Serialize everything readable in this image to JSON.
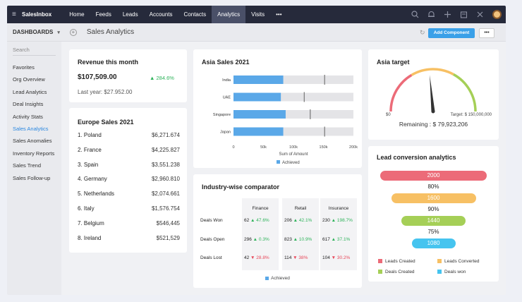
{
  "topbar": {
    "brand": "SalesInbox",
    "nav": [
      "Home",
      "Feeds",
      "Leads",
      "Accounts",
      "Contacts",
      "Analytics",
      "Visits",
      "•••"
    ],
    "active": "Analytics"
  },
  "subbar": {
    "dashboards_label": "DASHBOARDS",
    "breadcrumb": "Sales Analytics",
    "add_component": "Add Component",
    "more": "•••"
  },
  "sidebar": {
    "search_placeholder": "Search",
    "items": [
      "Favorites",
      "Org Overview",
      "Lead Analytics",
      "Deal Insights",
      "Activity Stats",
      "Sales Analytics",
      "Sales Anomalies",
      "Inventory Reports",
      "Sales Trend",
      "Sales Follow-up"
    ],
    "active": "Sales Analytics"
  },
  "revenue": {
    "title": "Revenue this month",
    "amount": "$107,509.00",
    "change": "284.6%",
    "last_year": "Last year:  $27.952.00"
  },
  "europe": {
    "title": "Europe Sales 2021",
    "rows": [
      {
        "name": "1. Poland",
        "value": "$6,271.674"
      },
      {
        "name": "2. France",
        "value": "$4,225.827"
      },
      {
        "name": "3. Spain",
        "value": "$3,551.238"
      },
      {
        "name": "4. Germany",
        "value": "$2,960.810"
      },
      {
        "name": "5. Netherlands",
        "value": "$2,074.661"
      },
      {
        "name": "6. Italy",
        "value": "$1,576.754"
      },
      {
        "name": "7. Belgium",
        "value": "$546,445"
      },
      {
        "name": "8. Ireland",
        "value": "$521,529"
      }
    ]
  },
  "asia_sales": {
    "title": "Asia Sales 2021",
    "xlabel": "Sum of Amount",
    "legend": "Achieved",
    "tick_labels": [
      "0",
      "50k",
      "100k",
      "150k",
      "200k"
    ]
  },
  "chart_data": {
    "type": "bar",
    "orientation": "horizontal",
    "title": "Asia Sales 2021",
    "categories": [
      "India",
      "UAE",
      "Singapore",
      "Japan"
    ],
    "series": [
      {
        "name": "Achieved",
        "values": [
          83000,
          79000,
          87000,
          83000
        ]
      }
    ],
    "targets": [
      152000,
      118000,
      128000,
      152000
    ],
    "xlabel": "Sum of Amount",
    "xlim": [
      0,
      200000
    ],
    "color": "#5aa8e8",
    "background_bar_color": "#e4e4e7",
    "legend_position": "bottom"
  },
  "industry": {
    "title": "Industry-wise comparator",
    "columns": [
      "Finance",
      "Retail",
      "Insurance"
    ],
    "rows": [
      {
        "label": "Deals Won",
        "cells": [
          {
            "v": "62",
            "d": "up",
            "p": "47.6%"
          },
          {
            "v": "206",
            "d": "up",
            "p": "42.1%"
          },
          {
            "v": "230",
            "d": "up",
            "p": "198.7%"
          }
        ]
      },
      {
        "label": "Deals Open",
        "cells": [
          {
            "v": "296",
            "d": "up",
            "p": "0.3%"
          },
          {
            "v": "823",
            "d": "up",
            "p": "10.9%"
          },
          {
            "v": "617",
            "d": "up",
            "p": "37.1%"
          }
        ]
      },
      {
        "label": "Deals Lost",
        "cells": [
          {
            "v": "42",
            "d": "down",
            "p": "28.8%"
          },
          {
            "v": "114",
            "d": "down",
            "p": "38%"
          },
          {
            "v": "104",
            "d": "down",
            "p": "30.2%"
          }
        ]
      }
    ],
    "legend": "Achieved"
  },
  "asia_target": {
    "title": "Asia target",
    "min_label": "$0",
    "target_label": "Target: $ 150,000,000",
    "remaining": "Remaining : $ 79,923,206",
    "needle_fraction": 0.47
  },
  "lead_conversion": {
    "title": "Lead conversion analytics",
    "stages": [
      {
        "value": "2000",
        "color": "#ec6b78"
      },
      {
        "value": "1600",
        "color": "#f7c064"
      },
      {
        "value": "1440",
        "color": "#a5cf57"
      },
      {
        "value": "1080",
        "color": "#46c4ef"
      }
    ],
    "rates": [
      "80%",
      "90%",
      "75%"
    ],
    "legend": [
      {
        "label": "Leads Created",
        "color": "#ec6b78"
      },
      {
        "label": "Leads Converted",
        "color": "#f7c064"
      },
      {
        "label": "Deals Created",
        "color": "#a5cf57"
      },
      {
        "label": "Deals won",
        "color": "#46c4ef"
      }
    ]
  }
}
